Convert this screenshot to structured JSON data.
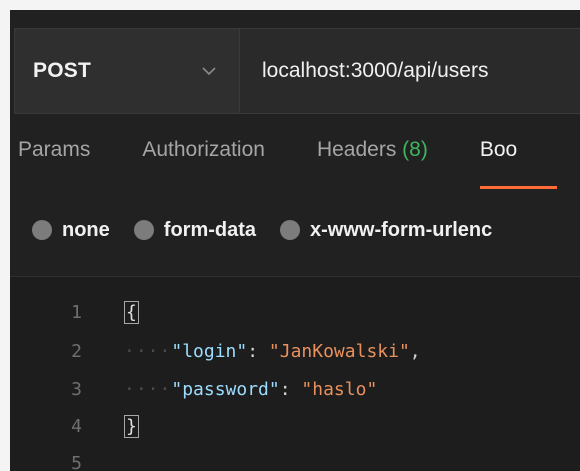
{
  "request": {
    "method": "POST",
    "url": "localhost:3000/api/users"
  },
  "tabs": [
    {
      "label": "Params"
    },
    {
      "label": "Authorization"
    },
    {
      "label": "Headers",
      "count": "(8)"
    },
    {
      "label": "Boo"
    }
  ],
  "body_types": [
    {
      "label": "none"
    },
    {
      "label": "form-data"
    },
    {
      "label": "x-www-form-urlenc"
    }
  ],
  "editor": {
    "line_numbers": [
      "1",
      "2",
      "3",
      "4",
      "5"
    ],
    "lines": [
      {
        "brace": "{"
      },
      {
        "dots": "····",
        "key": "\"login\"",
        "sep": ": ",
        "value": "\"JanKowalski\"",
        "end": ","
      },
      {
        "dots": "····",
        "key": "\"password\"",
        "sep": ": ",
        "value": "\"haslo\"",
        "end": ""
      },
      {
        "brace": "}"
      }
    ]
  },
  "colors": {
    "accent": "#ff6c37",
    "count_green": "#3fb55e",
    "json_key": "#9cdcfe",
    "json_string": "#e8915c"
  },
  "icons": {
    "method_dropdown": "chevron-down-icon"
  }
}
